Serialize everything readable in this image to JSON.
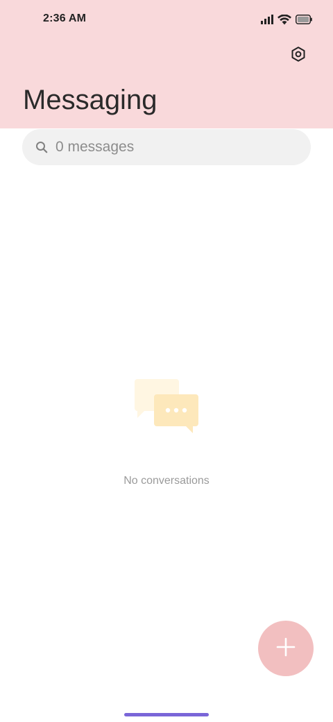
{
  "status_bar": {
    "time": "2:36 AM",
    "icons": [
      "signal-icon",
      "wifi-icon",
      "battery-icon"
    ]
  },
  "header": {
    "title": "Messaging",
    "settings_icon": "gear-icon",
    "background_color": "#f9d9db"
  },
  "search": {
    "placeholder": "0 messages",
    "icon": "search-icon"
  },
  "empty_state": {
    "illustration": "chat-bubbles-icon",
    "text": "No conversations"
  },
  "fab": {
    "icon": "plus-icon",
    "color": "#f2bfc0"
  },
  "home_indicator_color": "#7a66d8"
}
